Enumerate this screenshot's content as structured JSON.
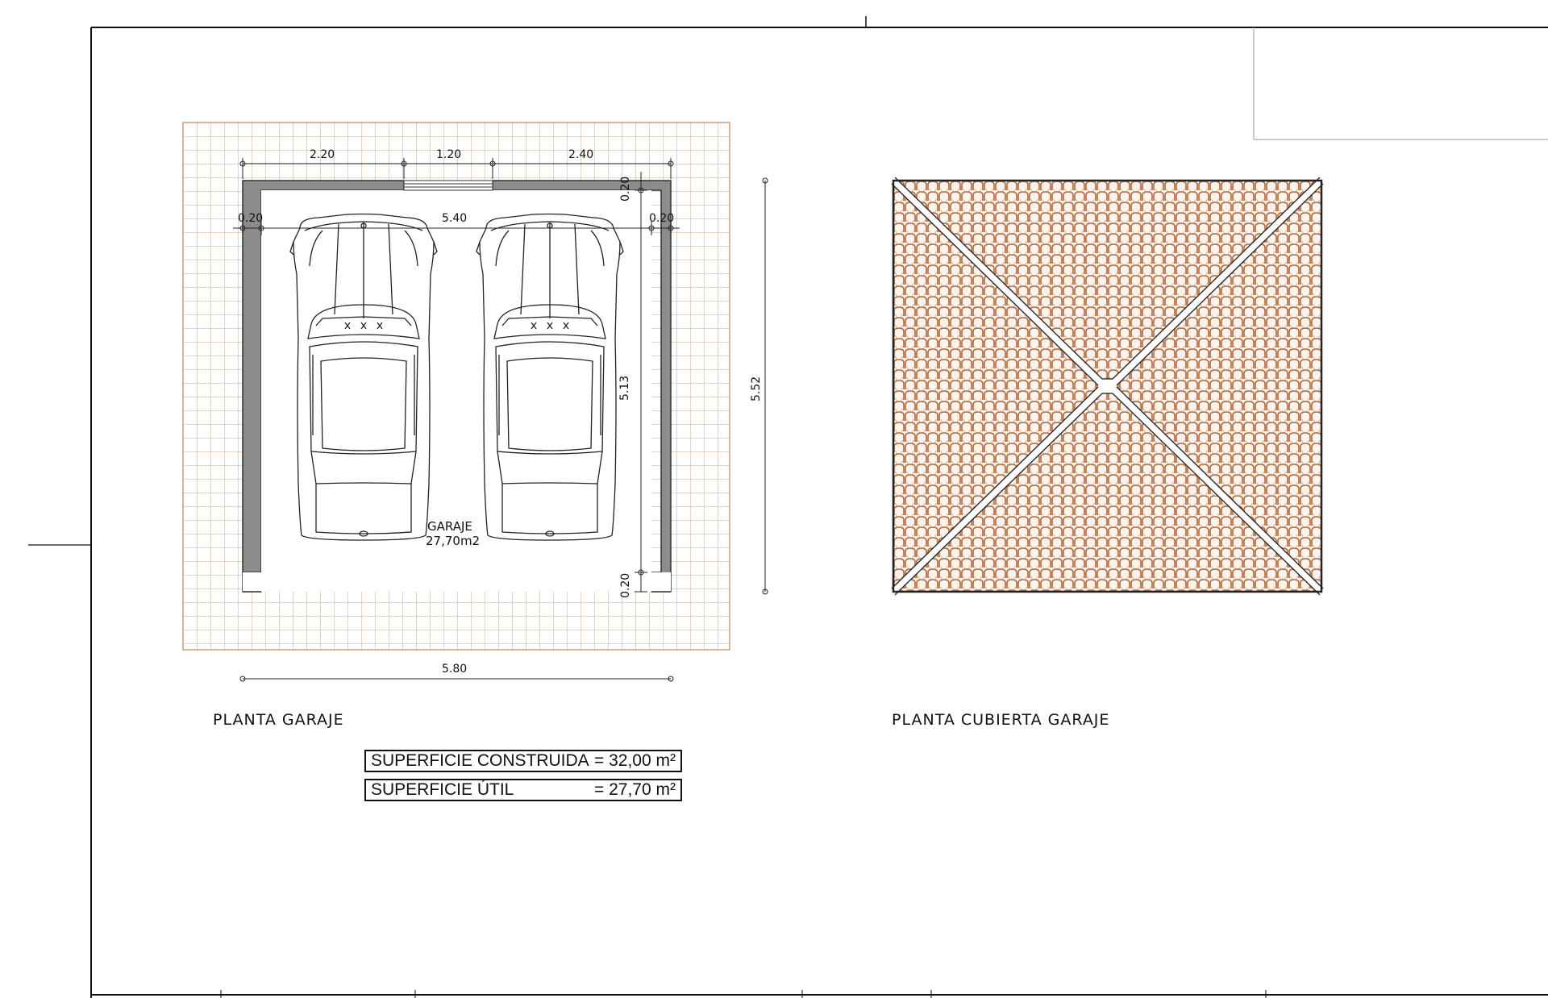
{
  "garage_plan": {
    "caption": "PLANTA GARAJE",
    "room_name": "GARAJE",
    "room_area": "27,70m2",
    "dimensions": {
      "top_left_segment": "2.20",
      "top_door_segment": "1.20",
      "top_right_segment": "2.40",
      "inner_width": "5.40",
      "left_wall": "0.20",
      "right_wall": "0.20",
      "top_wall": "0.20",
      "bottom_wall": "0.20",
      "inner_depth": "5.13",
      "overall_depth": "5.52",
      "overall_width": "5.80"
    },
    "colors": {
      "tile_grid": "#d8b89a",
      "wall_fill": "#8a8a8a",
      "line": "#111111"
    }
  },
  "roof_plan": {
    "caption": "PLANTA CUBIERTA GARAJE",
    "colors": {
      "tile_stroke": "#b06a3c",
      "tile_fill": "#f7ede4"
    }
  },
  "area_table": {
    "built": {
      "label": "SUPERFICIE CONSTRUIDA",
      "value": "= 32,00 m²"
    },
    "usable": {
      "label": "SUPERFICIE ÚTIL",
      "value": "= 27,70 m²"
    }
  }
}
